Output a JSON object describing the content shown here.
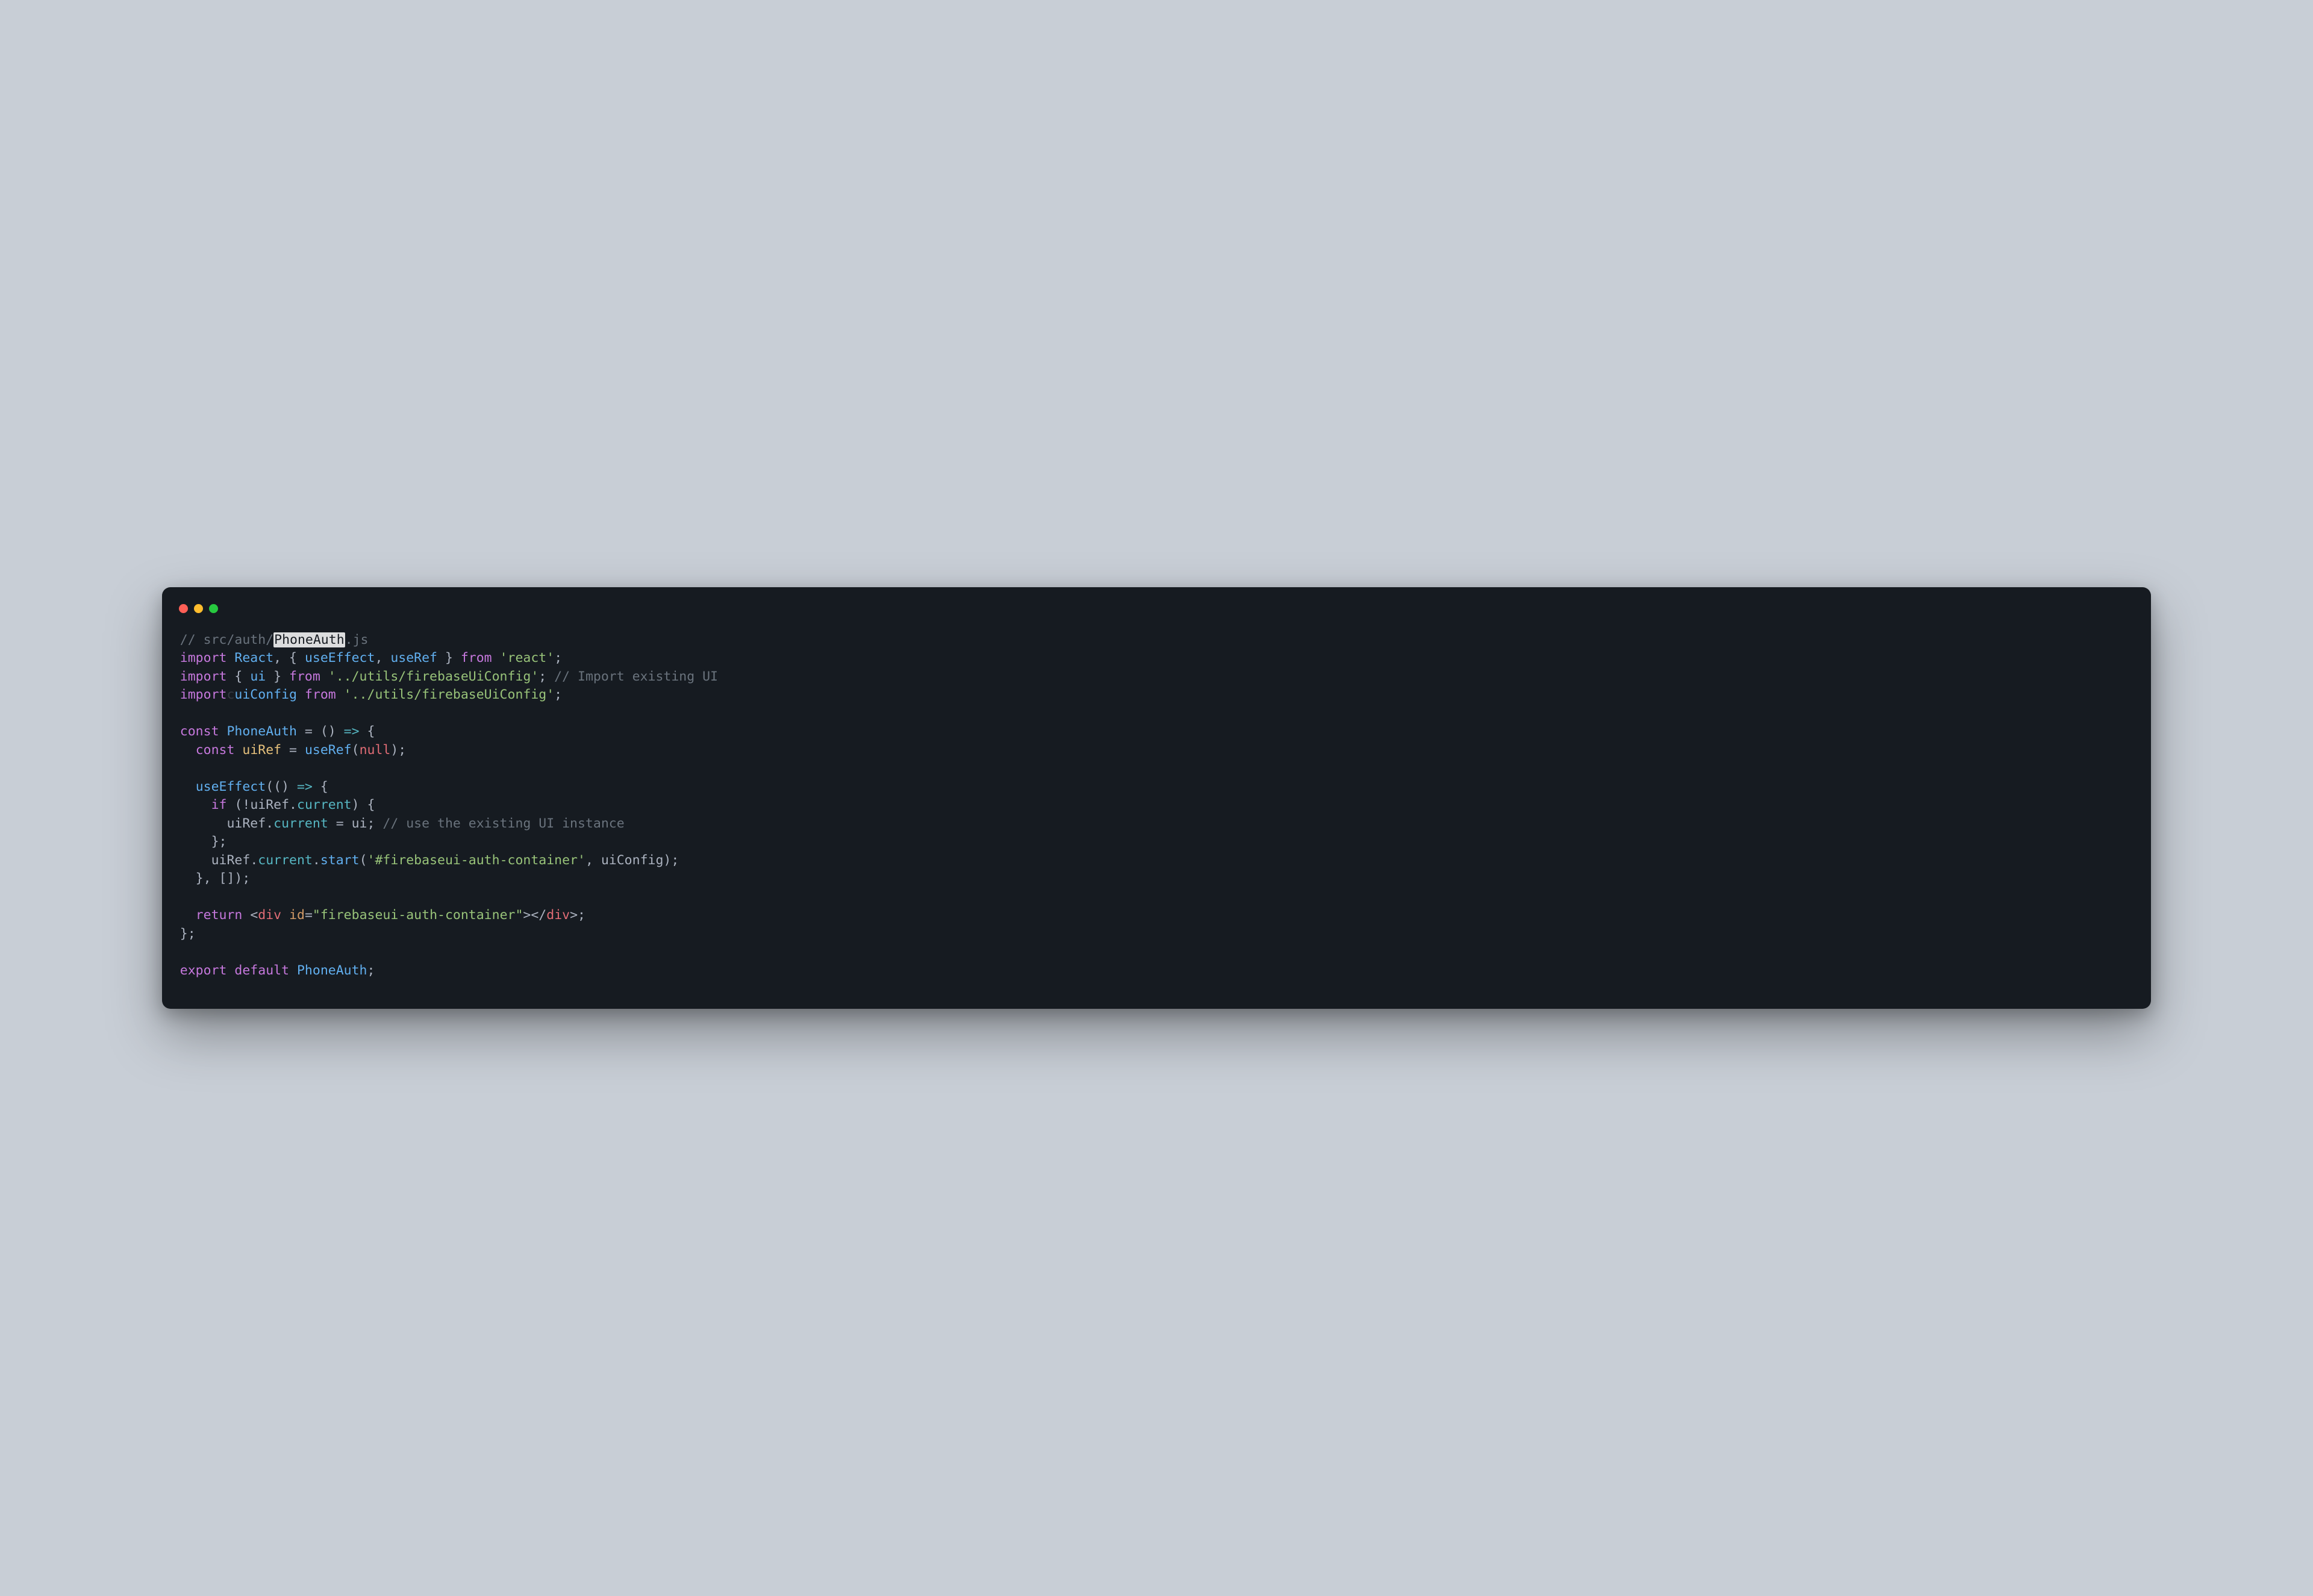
{
  "titlebar": {
    "close_color": "#ff5f56",
    "minimize_color": "#ffbd2e",
    "zoom_color": "#27c93f"
  },
  "code": {
    "c1a": "// src/auth/",
    "c1_hl": "PhoneAuth",
    "c1b": ".js",
    "l2_import": "import",
    "l2_react": "React",
    "l2_comma": ", { ",
    "l2_useEffect": "useEffect",
    "l2_sep": ", ",
    "l2_useRef": "useRef",
    "l2_close": " } ",
    "l2_from": "from",
    "l2_str": "'react'",
    "l2_semi": ";",
    "l3_import": "import",
    "l3_open": " { ",
    "l3_ui": "ui",
    "l3_close": " } ",
    "l3_from": "from",
    "l3_str": "'../utils/firebaseUiConfig'",
    "l3_semi": "; ",
    "l3_comment": "// Import existing UI",
    "l4_import": "import",
    "l4_ghost": "c",
    "l4_uiConfig": "uiConfig",
    "l4_from": "from",
    "l4_str": "'../utils/firebaseUiConfig'",
    "l4_semi": ";",
    "l6_const": "const",
    "l6_name": "PhoneAuth",
    "l6_eq": " = () ",
    "l6_arrow": "=>",
    "l6_brace": " {",
    "l7_const": "const",
    "l7_uiRef": "uiRef",
    "l7_eq": " = ",
    "l7_useRef": "useRef",
    "l7_open": "(",
    "l7_null": "null",
    "l7_close": ");",
    "l9_useEffect": "useEffect",
    "l9_rest": "(() ",
    "l9_arrow": "=>",
    "l9_brace": " {",
    "l10_if": "if",
    "l10_open": " (!",
    "l10_uiRef": "uiRef",
    "l10_dot": ".",
    "l10_current": "current",
    "l10_close": ") {",
    "l11_uiRef": "uiRef",
    "l11_dot": ".",
    "l11_current": "current",
    "l11_eq": " = ",
    "l11_ui": "ui",
    "l11_semi": "; ",
    "l11_comment": "// use the existing UI instance",
    "l12": "    };",
    "l13_uiRef": "uiRef",
    "l13_dot1": ".",
    "l13_current": "current",
    "l13_dot2": ".",
    "l13_start": "start",
    "l13_open": "(",
    "l13_str": "'#firebaseui-auth-container'",
    "l13_comma": ", ",
    "l13_uiConfig": "uiConfig",
    "l13_close": ");",
    "l14": "  }, []);",
    "l16_return": "return",
    "l16_sp": " ",
    "l16_lt": "<",
    "l16_div1": "div",
    "l16_sp2": " ",
    "l16_id": "id",
    "l16_eq": "=",
    "l16_str": "\"firebaseui-auth-container\"",
    "l16_gt": "></",
    "l16_div2": "div",
    "l16_end": ">;",
    "l17": "};",
    "l19_export": "export",
    "l19_default": "default",
    "l19_name": "PhoneAuth",
    "l19_semi": ";"
  }
}
